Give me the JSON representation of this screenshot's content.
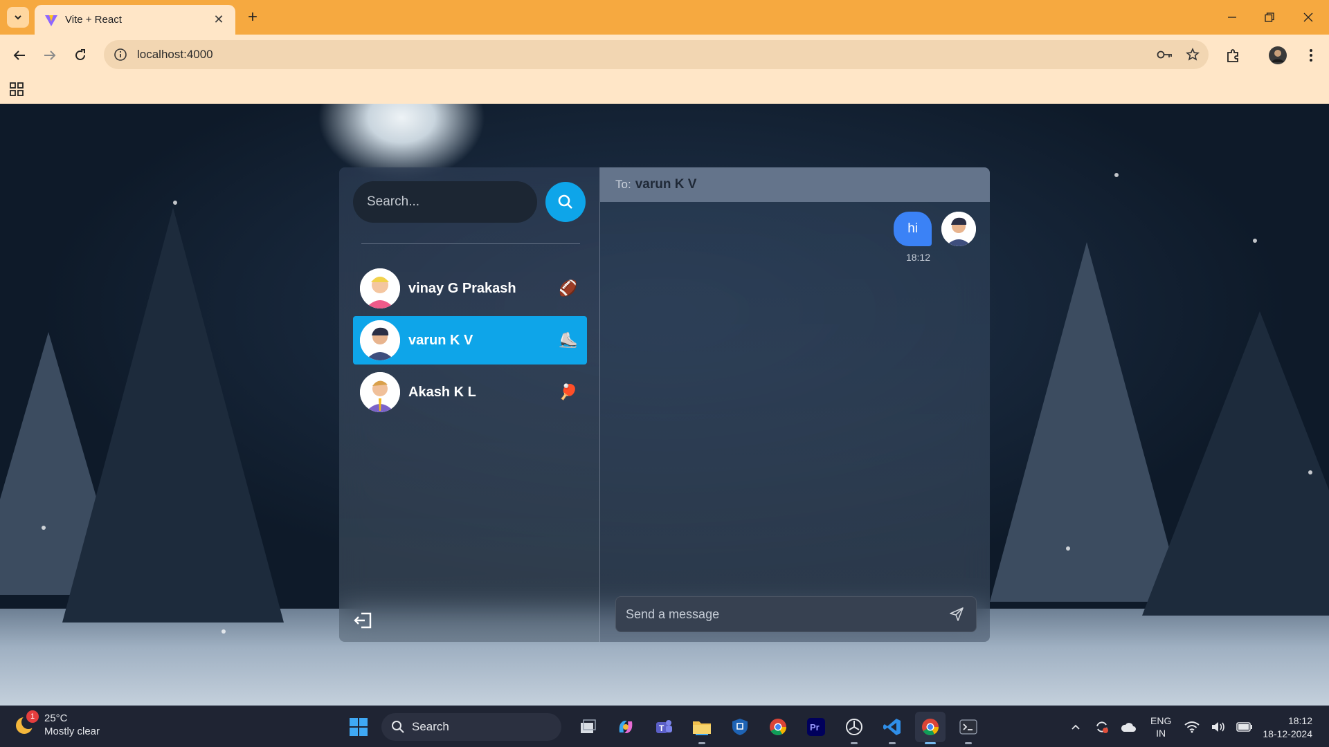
{
  "browser": {
    "tab": {
      "title": "Vite + React"
    },
    "address": {
      "url": "localhost:4000"
    }
  },
  "sidebar": {
    "search": {
      "placeholder": "Search..."
    },
    "conversations": [
      {
        "name": "vinay G Prakash",
        "emoji": "🏈",
        "active": false
      },
      {
        "name": "varun K V",
        "emoji": "⛸️",
        "active": true
      },
      {
        "name": "Akash K L",
        "emoji": "🏓",
        "active": false
      }
    ]
  },
  "chat": {
    "header": {
      "to_label": "To:",
      "recipient": "varun K V"
    },
    "messages": [
      {
        "text": "hi",
        "time": "18:12",
        "from_me": true
      }
    ],
    "composer": {
      "placeholder": "Send a message"
    }
  },
  "taskbar": {
    "weather": {
      "temp": "25°C",
      "condition": "Mostly clear",
      "badge": "1"
    },
    "search_label": "Search",
    "language": {
      "line1": "ENG",
      "line2": "IN"
    },
    "clock": {
      "time": "18:12",
      "date": "18-12-2024"
    }
  },
  "colors": {
    "browser_frame": "#f6a940",
    "browser_toolbar": "#ffe6c7",
    "accent": "#0ea5e9",
    "bubble": "#3b82f6",
    "chat_header": "#64748b"
  }
}
